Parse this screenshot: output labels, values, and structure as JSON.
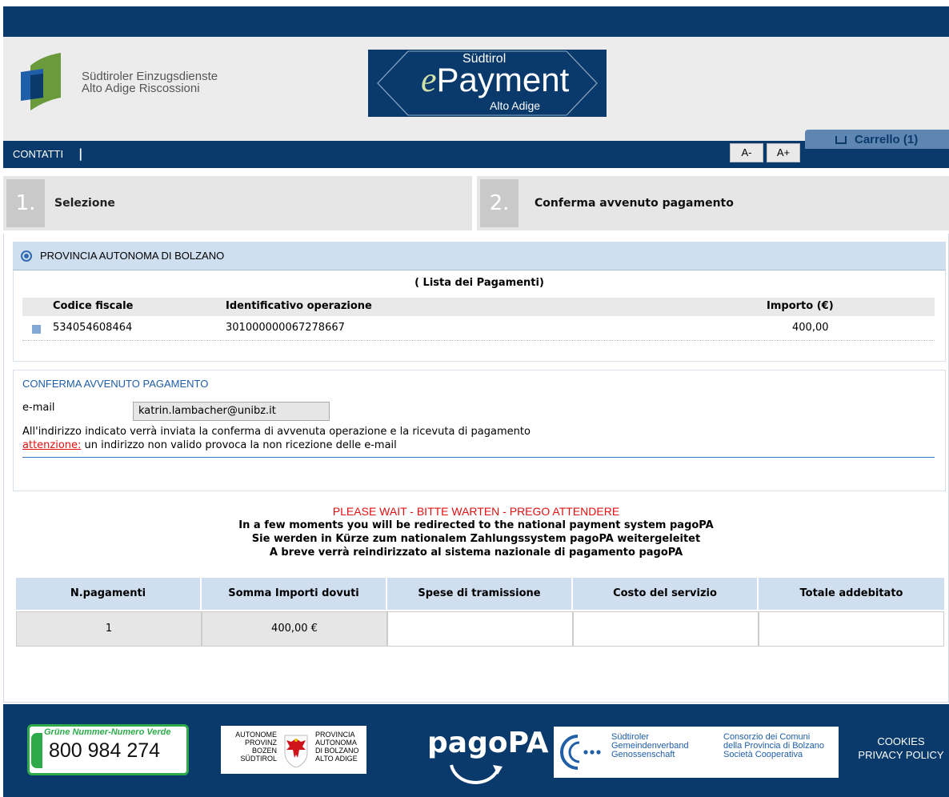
{
  "header": {
    "brand_line1": "Südtiroler Einzugsdienste",
    "brand_line2": "Alto Adige Riscossioni",
    "epay_top": "Südtirol",
    "epay_e": "e",
    "epay_main": "Payment",
    "epay_bottom": "Alto Adige"
  },
  "nav": {
    "contatti": "CONTATTI",
    "separator": "|",
    "font_minus": "A-",
    "font_plus": "A+",
    "cart": "Carrello (1)"
  },
  "steps": [
    {
      "num": "1.",
      "label": "Selezione"
    },
    {
      "num": "2.",
      "label": "Conferma avvenuto pagamento"
    }
  ],
  "ente": {
    "name": "PROVINCIA AUTONOMA DI BOLZANO",
    "list_title": "( Lista dei Pagamenti)",
    "headers": {
      "codice": "Codice fiscale",
      "ident": "Identificativo operazione",
      "importo": "Importo (€)"
    },
    "rows": [
      {
        "codice": "534054608464",
        "ident": "301000000067278667",
        "importo": "400,00"
      }
    ]
  },
  "conferma": {
    "title": "CONFERMA AVVENUTO PAGAMENTO",
    "email_label": "e-mail",
    "email_value": "katrin.lambacher@unibz.it",
    "info": "All'indirizzo indicato verrà inviata la conferma di avvenuta operazione e la ricevuta di pagamento",
    "warning_label": "attenzione:",
    "warning_text": " un indirizzo non valido provoca la non ricezione delle e-mail"
  },
  "wait": {
    "title": "PLEASE WAIT - BITTE WARTEN - PREGO ATTENDERE",
    "line_en": "In a few moments you will be redirected to the national payment system pagoPA",
    "line_de": "Sie werden in Kürze zum nationalem Zahlungssystem pagoPA weitergeleitet",
    "line_it": "A breve verrà reindirizzato al sistema nazionale di pagamento pagoPA"
  },
  "totals": {
    "headers": [
      "N.pagamenti",
      "Somma Importi dovuti",
      "Spese di tramissione",
      "Costo del servizio",
      "Totale addebitato"
    ],
    "values": [
      "1",
      "400,00 €",
      "",
      "",
      ""
    ]
  },
  "footer": {
    "verde_label": "Grüne Nummer-Numero Verde",
    "verde_number": "800 984 274",
    "prov_de_1": "AUTONOME",
    "prov_de_2": "PROVINZ",
    "prov_de_3": "BOZEN",
    "prov_de_4": "SÜDTIROL",
    "prov_it_1": "PROVINCIA",
    "prov_it_2": "AUTONOMA",
    "prov_it_3": "DI BOLZANO",
    "prov_it_4": "ALTO ADIGE",
    "pagopa": "pagoPA",
    "cons_de_1": "Südtiroler",
    "cons_de_2": "Gemeindenverband",
    "cons_de_3": "Genossenschaft",
    "cons_it_1": "Consorzio dei Comuni",
    "cons_it_2": "della Provincia di Bolzano",
    "cons_it_3": "Società Cooperativa",
    "cookies": "COOKIES",
    "privacy": "PRIVACY POLICY"
  },
  "colors": {
    "navy": "#0a3a6b",
    "light_blue": "#cfdff0",
    "accent_red": "#e01010",
    "link_blue": "#1f5ea8",
    "green": "#2eaa4a"
  }
}
